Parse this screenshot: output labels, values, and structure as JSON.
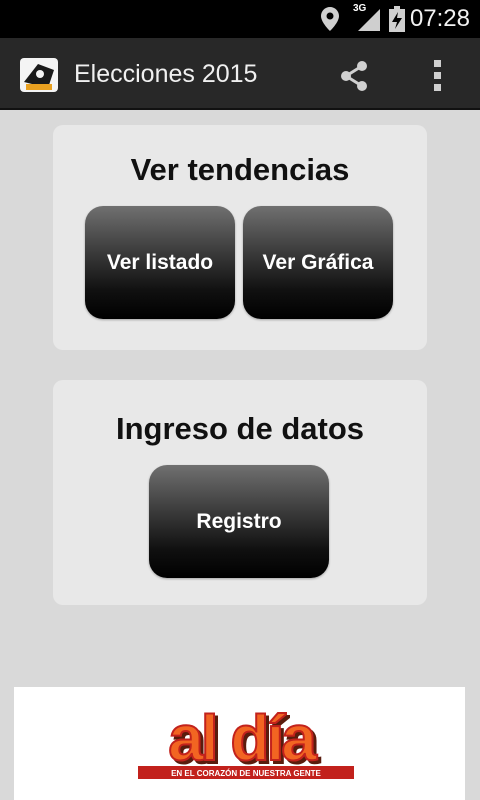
{
  "status_bar": {
    "time": "07:28",
    "network": "3G",
    "icons": [
      "location-icon",
      "signal-3g-icon",
      "battery-charging-icon"
    ]
  },
  "action_bar": {
    "title": "Elecciones 2015",
    "icons": [
      "app-logo-icon",
      "share-icon",
      "overflow-menu-icon"
    ]
  },
  "tendencias": {
    "title": "Ver tendencias",
    "btn_listado": "Ver listado",
    "btn_grafica": "Ver Gráfica"
  },
  "ingreso": {
    "title": "Ingreso de datos",
    "btn_registro": "Registro"
  },
  "banner": {
    "logo_text": "al día",
    "tagline": "EN EL CORAZÓN DE NUESTRA GENTE"
  },
  "colors": {
    "brand_orange": "#f26522",
    "brand_red": "#c2211c",
    "action_bar": "#282828"
  }
}
